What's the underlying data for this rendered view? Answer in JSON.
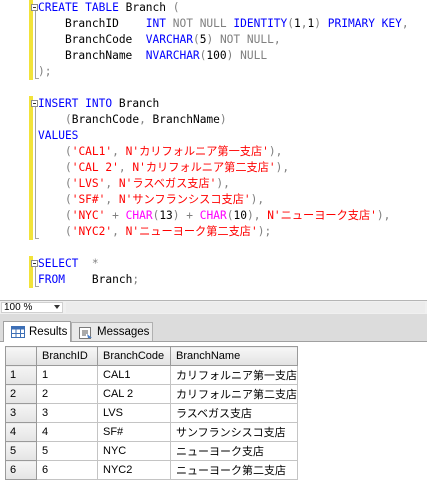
{
  "editor": {
    "lines": [
      [
        {
          "t": "CREATE",
          "c": "kw"
        },
        {
          "t": " ",
          "c": "tx"
        },
        {
          "t": "TABLE",
          "c": "kw"
        },
        {
          "t": " Branch ",
          "c": "tx"
        },
        {
          "t": "(",
          "c": "gr"
        }
      ],
      [
        {
          "t": "    BranchID    ",
          "c": "tx"
        },
        {
          "t": "INT",
          "c": "kw"
        },
        {
          "t": " ",
          "c": "tx"
        },
        {
          "t": "NOT NULL",
          "c": "gr"
        },
        {
          "t": " ",
          "c": "tx"
        },
        {
          "t": "IDENTITY",
          "c": "kw"
        },
        {
          "t": "(",
          "c": "gr"
        },
        {
          "t": "1",
          "c": "tx"
        },
        {
          "t": ",",
          "c": "gr"
        },
        {
          "t": "1",
          "c": "tx"
        },
        {
          "t": ")",
          "c": "gr"
        },
        {
          "t": " ",
          "c": "tx"
        },
        {
          "t": "PRIMARY KEY",
          "c": "kw"
        },
        {
          "t": ",",
          "c": "gr"
        }
      ],
      [
        {
          "t": "    BranchCode  ",
          "c": "tx"
        },
        {
          "t": "VARCHAR",
          "c": "kw"
        },
        {
          "t": "(",
          "c": "gr"
        },
        {
          "t": "5",
          "c": "tx"
        },
        {
          "t": ")",
          "c": "gr"
        },
        {
          "t": " ",
          "c": "tx"
        },
        {
          "t": "NOT NULL",
          "c": "gr"
        },
        {
          "t": ",",
          "c": "gr"
        }
      ],
      [
        {
          "t": "    BranchName  ",
          "c": "tx"
        },
        {
          "t": "NVARCHAR",
          "c": "kw"
        },
        {
          "t": "(",
          "c": "gr"
        },
        {
          "t": "100",
          "c": "tx"
        },
        {
          "t": ")",
          "c": "gr"
        },
        {
          "t": " ",
          "c": "tx"
        },
        {
          "t": "NULL",
          "c": "gr"
        }
      ],
      [
        {
          "t": ");",
          "c": "gr"
        }
      ],
      [],
      [
        {
          "t": "INSERT",
          "c": "kw"
        },
        {
          "t": " ",
          "c": "tx"
        },
        {
          "t": "INTO",
          "c": "kw"
        },
        {
          "t": " Branch",
          "c": "tx"
        }
      ],
      [
        {
          "t": "    ",
          "c": "tx"
        },
        {
          "t": "(",
          "c": "gr"
        },
        {
          "t": "BranchCode",
          "c": "tx"
        },
        {
          "t": ",",
          "c": "gr"
        },
        {
          "t": " BranchName",
          "c": "tx"
        },
        {
          "t": ")",
          "c": "gr"
        }
      ],
      [
        {
          "t": "VALUES",
          "c": "kw"
        }
      ],
      [
        {
          "t": "    ",
          "c": "tx"
        },
        {
          "t": "(",
          "c": "gr"
        },
        {
          "t": "'CAL1'",
          "c": "st"
        },
        {
          "t": ",",
          "c": "gr"
        },
        {
          "t": " ",
          "c": "tx"
        },
        {
          "t": "N'カリフォルニア第一支店'",
          "c": "st"
        },
        {
          "t": "),",
          "c": "gr"
        }
      ],
      [
        {
          "t": "    ",
          "c": "tx"
        },
        {
          "t": "(",
          "c": "gr"
        },
        {
          "t": "'CAL 2'",
          "c": "st"
        },
        {
          "t": ",",
          "c": "gr"
        },
        {
          "t": " ",
          "c": "tx"
        },
        {
          "t": "N'カリフォルニア第二支店'",
          "c": "st"
        },
        {
          "t": "),",
          "c": "gr"
        }
      ],
      [
        {
          "t": "    ",
          "c": "tx"
        },
        {
          "t": "(",
          "c": "gr"
        },
        {
          "t": "'LVS'",
          "c": "st"
        },
        {
          "t": ",",
          "c": "gr"
        },
        {
          "t": " ",
          "c": "tx"
        },
        {
          "t": "N'ラスベガス支店'",
          "c": "st"
        },
        {
          "t": "),",
          "c": "gr"
        }
      ],
      [
        {
          "t": "    ",
          "c": "tx"
        },
        {
          "t": "(",
          "c": "gr"
        },
        {
          "t": "'SF#'",
          "c": "st"
        },
        {
          "t": ",",
          "c": "gr"
        },
        {
          "t": " ",
          "c": "tx"
        },
        {
          "t": "N'サンフランシスコ支店'",
          "c": "st"
        },
        {
          "t": "),",
          "c": "gr"
        }
      ],
      [
        {
          "t": "    ",
          "c": "tx"
        },
        {
          "t": "(",
          "c": "gr"
        },
        {
          "t": "'NYC'",
          "c": "st"
        },
        {
          "t": " + ",
          "c": "gr"
        },
        {
          "t": "CHAR",
          "c": "fn"
        },
        {
          "t": "(",
          "c": "gr"
        },
        {
          "t": "13",
          "c": "tx"
        },
        {
          "t": ")",
          "c": "gr"
        },
        {
          "t": " + ",
          "c": "gr"
        },
        {
          "t": "CHAR",
          "c": "fn"
        },
        {
          "t": "(",
          "c": "gr"
        },
        {
          "t": "10",
          "c": "tx"
        },
        {
          "t": "),",
          "c": "gr"
        },
        {
          "t": " ",
          "c": "tx"
        },
        {
          "t": "N'ニューヨーク支店'",
          "c": "st"
        },
        {
          "t": "),",
          "c": "gr"
        }
      ],
      [
        {
          "t": "    ",
          "c": "tx"
        },
        {
          "t": "(",
          "c": "gr"
        },
        {
          "t": "'NYC2'",
          "c": "st"
        },
        {
          "t": ",",
          "c": "gr"
        },
        {
          "t": " ",
          "c": "tx"
        },
        {
          "t": "N'ニューヨーク第二支店'",
          "c": "st"
        },
        {
          "t": ");",
          "c": "gr"
        }
      ],
      [],
      [
        {
          "t": "SELECT",
          "c": "kw"
        },
        {
          "t": "  ",
          "c": "tx"
        },
        {
          "t": "*",
          "c": "gr"
        }
      ],
      [
        {
          "t": "FROM",
          "c": "kw"
        },
        {
          "t": "    Branch",
          "c": "tx"
        },
        {
          "t": ";",
          "c": "gr"
        }
      ]
    ]
  },
  "zoom": {
    "value": "100 %"
  },
  "tabs": {
    "results": "Results",
    "messages": "Messages"
  },
  "grid": {
    "columns": [
      "BranchID",
      "BranchCode",
      "BranchName"
    ],
    "rows": [
      {
        "num": "1",
        "id": "1",
        "code": "CAL1",
        "name": "カリフォルニア第一支店"
      },
      {
        "num": "2",
        "id": "2",
        "code": "CAL 2",
        "name": "カリフォルニア第二支店"
      },
      {
        "num": "3",
        "id": "3",
        "code": "LVS",
        "name": "ラスベガス支店"
      },
      {
        "num": "4",
        "id": "4",
        "code": "SF#",
        "name": "サンフランシスコ支店"
      },
      {
        "num": "5",
        "id": "5",
        "code": "NYC",
        "name": "ニューヨーク支店"
      },
      {
        "num": "6",
        "id": "6",
        "code": "NYC2",
        "name": "ニューヨーク第二支店"
      }
    ]
  },
  "colors": {
    "keyword": "#0000ff",
    "operator": "#808080",
    "string": "#ff0000",
    "function": "#ff00ff",
    "change_marker": "#f2e33a"
  }
}
